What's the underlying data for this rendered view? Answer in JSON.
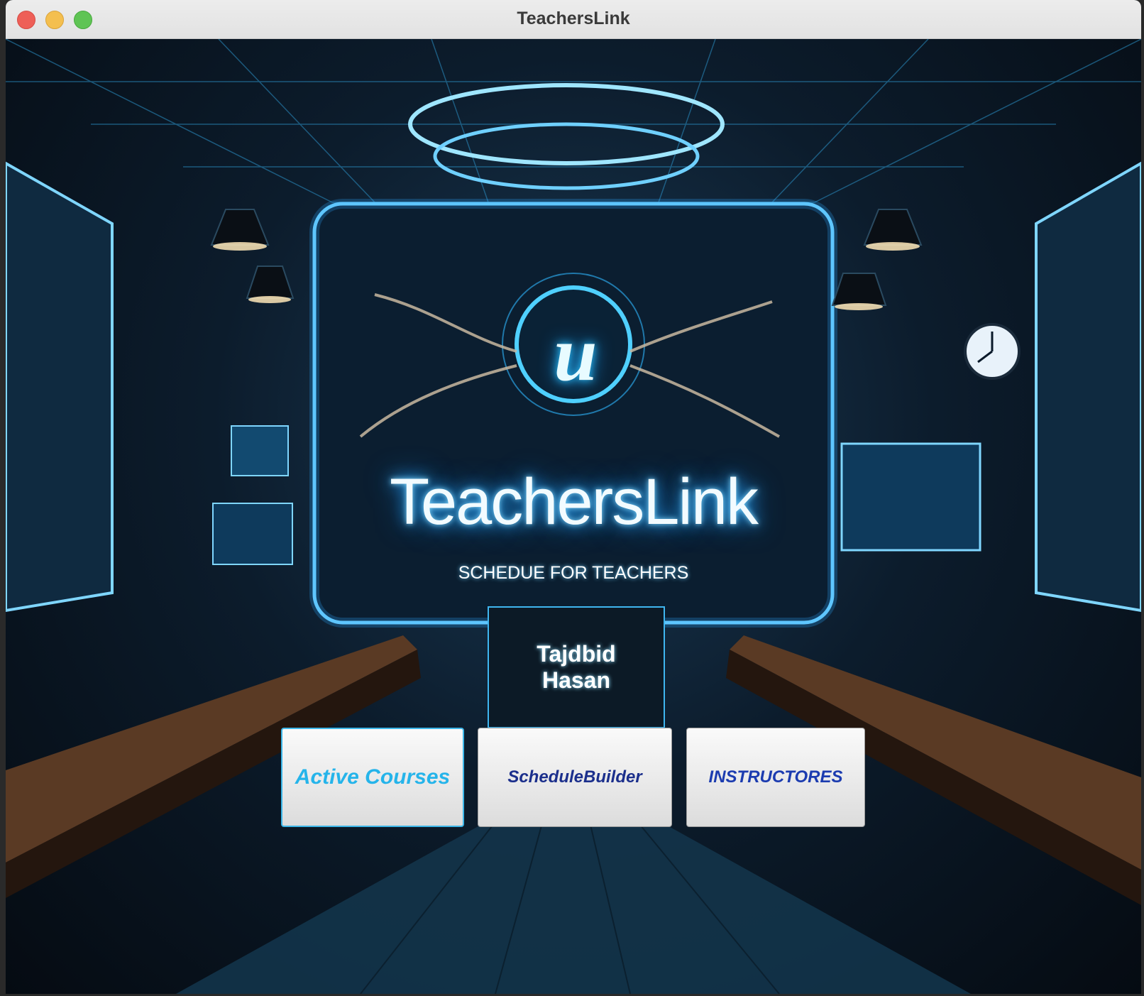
{
  "window": {
    "title": "TeachersLink"
  },
  "hero": {
    "logo_letter": "u",
    "title": "TeachersLink",
    "subtitle": "SCHEDUE FOR TEACHERS",
    "podium_name": "Tajdbid Hasan"
  },
  "buttons": {
    "active_courses": "Active Courses",
    "schedule_builder": "ScheduleBuilder",
    "instructores": "INSTRUCTORES"
  },
  "colors": {
    "accent_glow": "#2aa6ff",
    "active_courses_text": "#25b4ea",
    "schedule_builder_text": "#1b2f8c",
    "instructores_text": "#1c3cb0"
  }
}
